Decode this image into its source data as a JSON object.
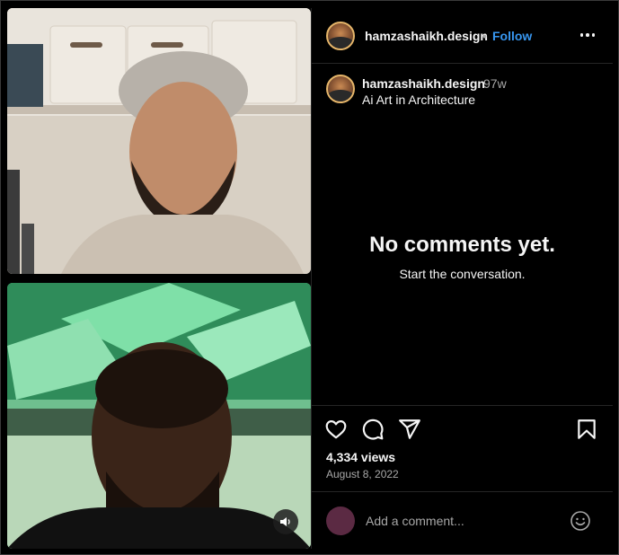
{
  "post": {
    "username": "hamzashaikh.design",
    "separator": "•",
    "follow_label": "Follow",
    "caption_username": "hamzashaikh.design",
    "time_ago": "97w",
    "caption": "Ai Art in Architecture"
  },
  "comments": {
    "empty_title": "No comments yet.",
    "empty_subtitle": "Start the conversation."
  },
  "stats": {
    "views": "4,334 views",
    "date": "August 8, 2022"
  },
  "composer": {
    "placeholder": "Add a comment..."
  },
  "icons": {
    "more": "more-options-icon",
    "like": "heart-icon",
    "comment": "comment-bubble-icon",
    "share": "paper-plane-icon",
    "save": "bookmark-icon",
    "emoji": "emoji-smile-icon",
    "sound": "speaker-icon"
  },
  "colors": {
    "background": "#000000",
    "link": "#3897f0",
    "muted": "#a8a8a8",
    "avatar_ring": "#e6b66a",
    "comment_avatar": "#5b2a43"
  }
}
